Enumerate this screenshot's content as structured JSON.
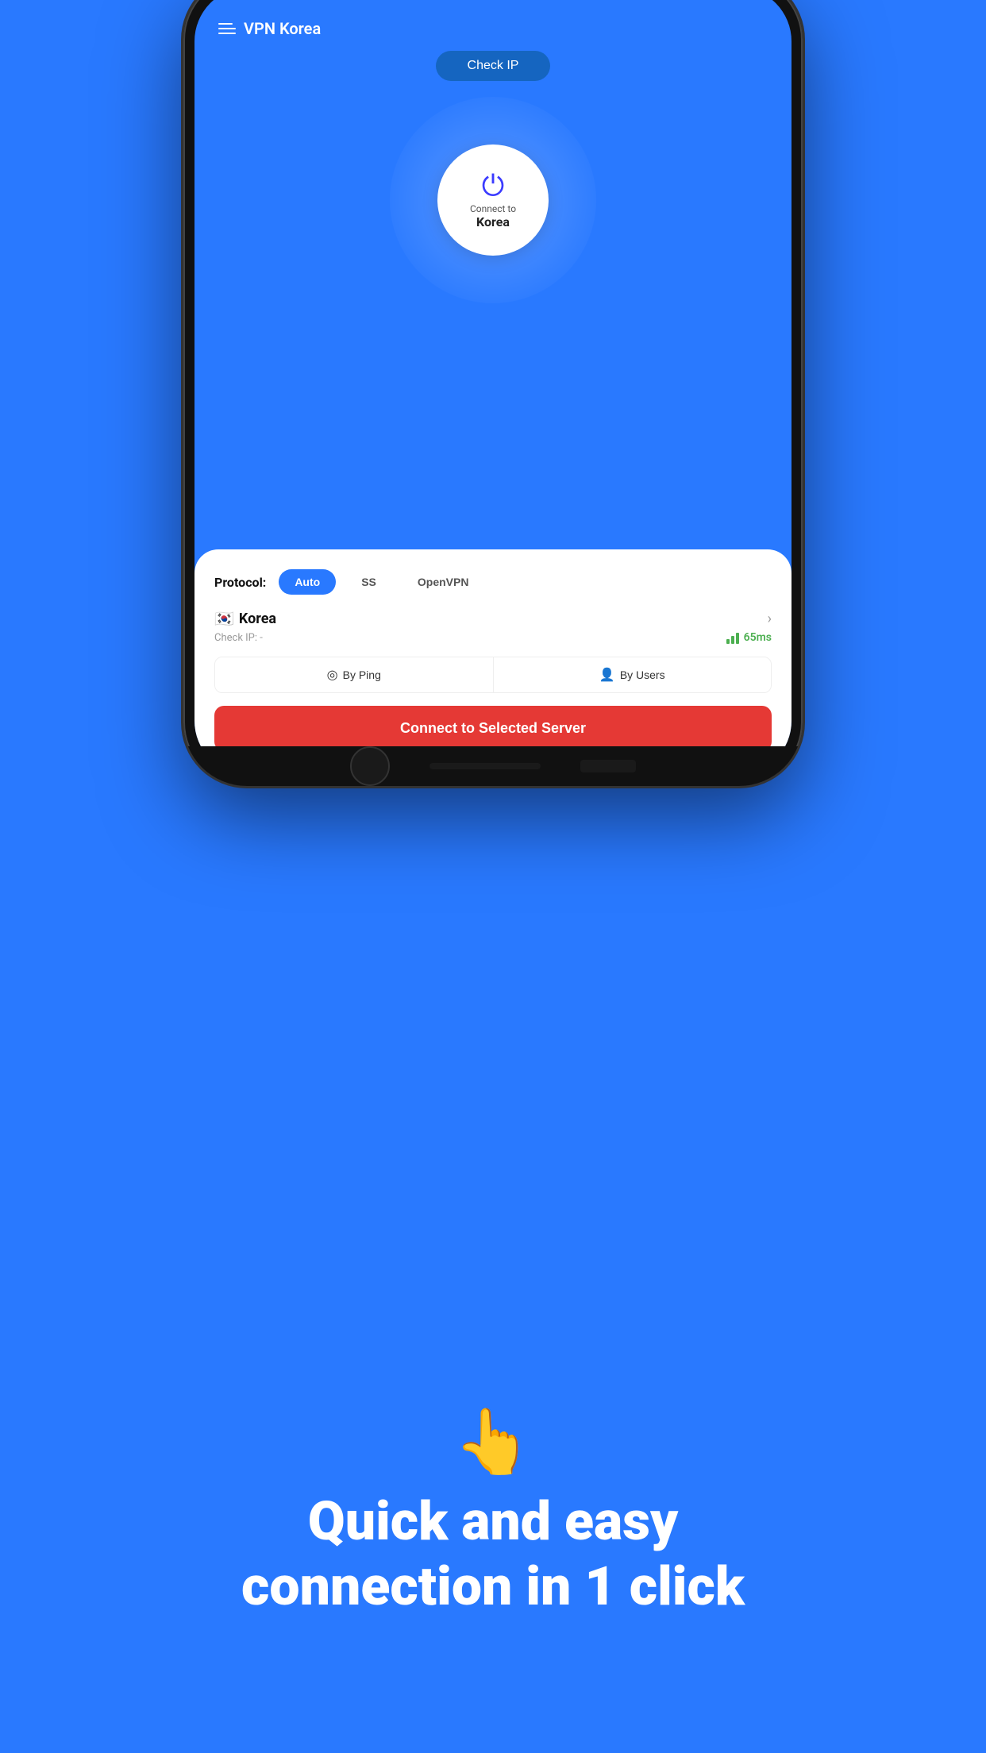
{
  "background_color": "#2979FF",
  "app": {
    "title": "VPN Korea",
    "check_ip_btn": "Check IP",
    "connect_label": "Connect to",
    "connect_country": "Korea"
  },
  "protocol": {
    "label": "Protocol:",
    "options": [
      "Auto",
      "SS",
      "OpenVPN"
    ],
    "active": "Auto"
  },
  "server": {
    "flag": "🇰🇷",
    "name": "Korea",
    "check_ip_label": "Check IP: -",
    "ping": "65ms"
  },
  "sort": {
    "by_ping": "By Ping",
    "by_users": "By Users"
  },
  "connect_btn": "Connect to Selected Server",
  "tagline": {
    "hand_emoji": "👆",
    "text_line1": "Quick and easy",
    "text_line2": "connection in 1 click"
  }
}
